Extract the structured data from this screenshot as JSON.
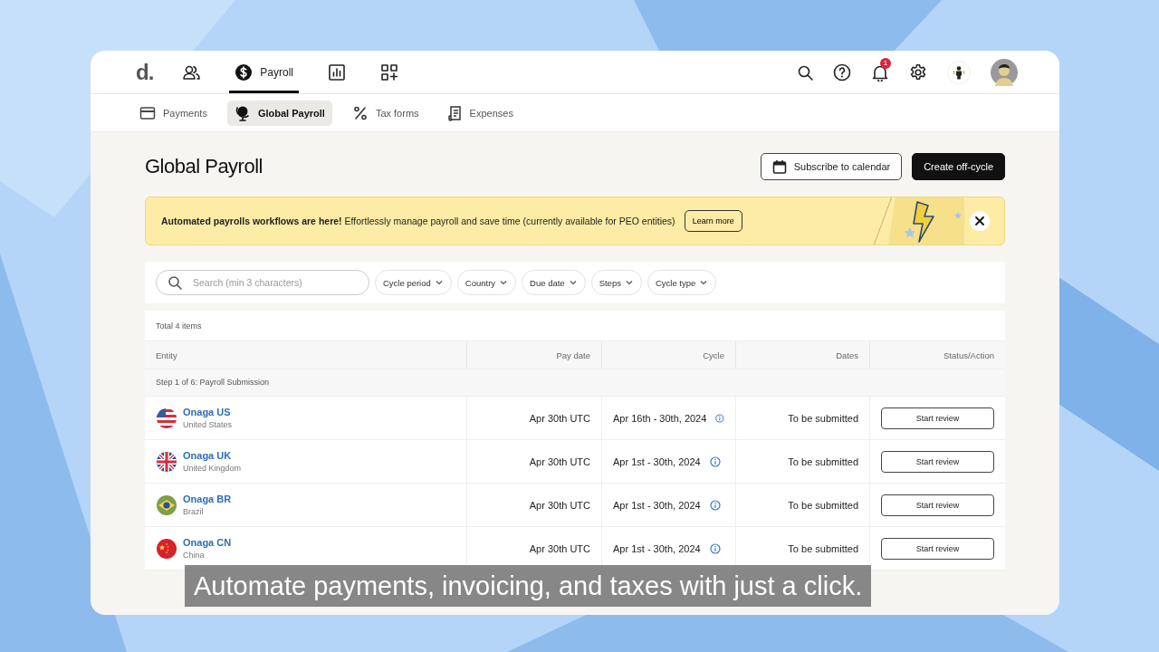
{
  "app": {
    "logo": "d.",
    "nav_tabs": [
      {
        "kind": "people",
        "selected": false
      },
      {
        "kind": "payroll",
        "label": "Payroll",
        "selected": true
      },
      {
        "kind": "chart",
        "selected": false
      },
      {
        "kind": "apps",
        "selected": false
      }
    ],
    "notification_count": "1"
  },
  "sub_tabs": [
    {
      "kind": "card",
      "label": "Payments",
      "selected": false
    },
    {
      "kind": "globe",
      "label": "Global Payroll",
      "selected": true
    },
    {
      "kind": "percent",
      "label": "Tax forms",
      "selected": false
    },
    {
      "kind": "receipt",
      "label": "Expenses",
      "selected": false
    }
  ],
  "page": {
    "title": "Global Payroll",
    "buttons": [
      {
        "kind": "secondary",
        "label": "Subscribe to calendar"
      },
      {
        "kind": "primary",
        "label": "Create off-cycle"
      }
    ]
  },
  "banner": {
    "text": "**Automated payrolls workflows are here!** Effortlessly manage payroll and save time (currently available for PEO entities)",
    "button": "Learn more"
  },
  "filters": {
    "search_placeholder": "Search (min 3 characters)",
    "chips": [
      "Cycle period",
      "Country",
      "Due date",
      "Steps",
      "Cycle type"
    ]
  },
  "table": {
    "total": "Total 4 items",
    "columns": [
      "Entity",
      "Pay date",
      "Cycle",
      "Dates",
      "Status/Action"
    ],
    "group": "Step 1 of 6: Payroll Submission",
    "rows": [
      {
        "kind": "us",
        "name": "Onaga US",
        "country": "United States",
        "pay_date": "Apr 30th UTC",
        "cycle": "Apr 16th - 30th, 2024",
        "dates": "To be submitted",
        "action": "Start review"
      },
      {
        "kind": "uk",
        "name": "Onaga UK",
        "country": "United Kingdom",
        "pay_date": "Apr 30th UTC",
        "cycle": "Apr 1st - 30th, 2024",
        "dates": "To be submitted",
        "action": "Start review"
      },
      {
        "kind": "br",
        "name": "Onaga BR",
        "country": "Brazil",
        "pay_date": "Apr 30th UTC",
        "cycle": "Apr 1st - 30th, 2024",
        "dates": "To be submitted",
        "action": "Start review"
      },
      {
        "kind": "cn",
        "name": "Onaga CN",
        "country": "China",
        "pay_date": "Apr 30th UTC",
        "cycle": "Apr 1st - 30th, 2024",
        "dates": "To be submitted",
        "action": "Start review"
      }
    ]
  },
  "caption": "Automate payments, invoicing, and taxes with just a click."
}
